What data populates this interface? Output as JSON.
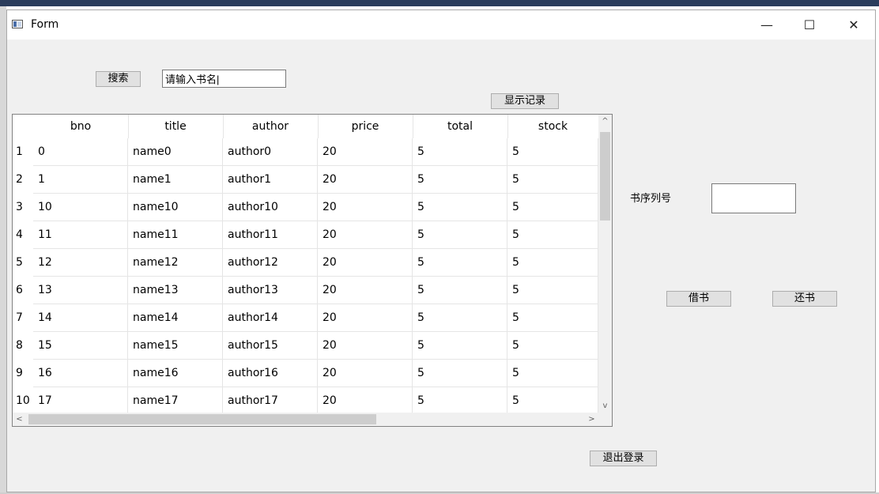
{
  "window": {
    "title": "Form",
    "minimize_glyph": "—",
    "maximize_glyph": "☐",
    "close_glyph": "✕"
  },
  "search": {
    "button_label": "搜索",
    "input_value": "请输入书名|"
  },
  "show_records_label": "显示记录",
  "table": {
    "columns": [
      "bno",
      "title",
      "author",
      "price",
      "total",
      "stock"
    ],
    "rows": [
      {
        "num": "1",
        "cells": [
          "0",
          "name0",
          "author0",
          "20",
          "5",
          "5"
        ]
      },
      {
        "num": "2",
        "cells": [
          "1",
          "name1",
          "author1",
          "20",
          "5",
          "5"
        ]
      },
      {
        "num": "3",
        "cells": [
          "10",
          "name10",
          "author10",
          "20",
          "5",
          "5"
        ]
      },
      {
        "num": "4",
        "cells": [
          "11",
          "name11",
          "author11",
          "20",
          "5",
          "5"
        ]
      },
      {
        "num": "5",
        "cells": [
          "12",
          "name12",
          "author12",
          "20",
          "5",
          "5"
        ]
      },
      {
        "num": "6",
        "cells": [
          "13",
          "name13",
          "author13",
          "20",
          "5",
          "5"
        ]
      },
      {
        "num": "7",
        "cells": [
          "14",
          "name14",
          "author14",
          "20",
          "5",
          "5"
        ]
      },
      {
        "num": "8",
        "cells": [
          "15",
          "name15",
          "author15",
          "20",
          "5",
          "5"
        ]
      },
      {
        "num": "9",
        "cells": [
          "16",
          "name16",
          "author16",
          "20",
          "5",
          "5"
        ]
      },
      {
        "num": "10",
        "cells": [
          "17",
          "name17",
          "author17",
          "20",
          "5",
          "5"
        ]
      }
    ],
    "scroll_glyphs": {
      "up": "^",
      "down": "v",
      "left": "<",
      "right": ">"
    }
  },
  "serial_label": "书序列号",
  "serial_value": "",
  "borrow_label": "借书",
  "return_label": "还书",
  "logout_label": "退出登录"
}
